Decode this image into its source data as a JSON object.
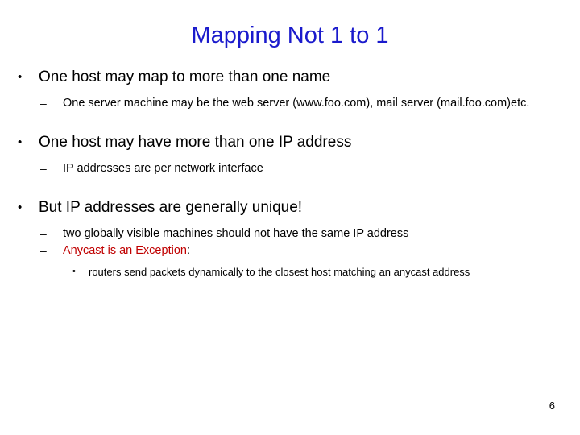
{
  "slide": {
    "title": "Mapping Not 1 to 1",
    "title_color": "#1a1acc",
    "background_color": "#ffffff",
    "page_number": "6",
    "accent_color": "#c00000",
    "body_color": "#000000",
    "bullet_markers": {
      "level1": "•",
      "level2": "–",
      "level3": "•"
    },
    "outline": {
      "b1": {
        "text": "One host may map to more than one name",
        "sub1": "One server machine may be the web server (www.foo.com), mail server (mail.foo.com)etc."
      },
      "b2": {
        "text": "One host may have more than one IP address",
        "sub1": "IP addresses are per network interface"
      },
      "b3": {
        "text": "But IP addresses are generally unique!",
        "sub1": "two globally visible machines should not have the same IP address",
        "sub2_red": "Anycast is an Exception",
        "sub2_tail": ":",
        "sub2_sub1": "routers send packets dynamically to the closest host matching an anycast address"
      }
    }
  }
}
